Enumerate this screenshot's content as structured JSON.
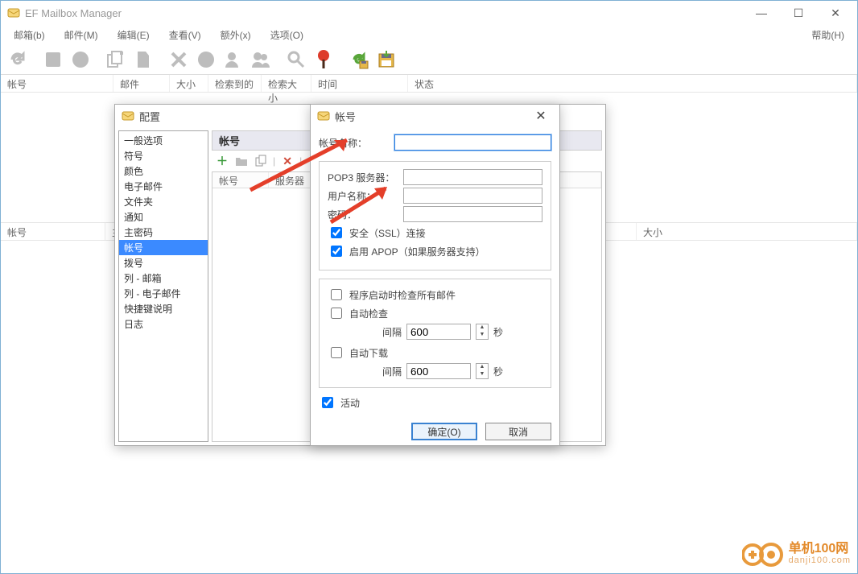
{
  "app": {
    "title": "EF Mailbox Manager"
  },
  "menu": {
    "mailbox": "邮箱(b)",
    "mail": "邮件(M)",
    "edit": "编辑(E)",
    "view": "查看(V)",
    "extra": "额外(x)",
    "options": "选项(O)",
    "help": "帮助(H)"
  },
  "upper_cols": {
    "account": "帐号",
    "mail": "邮件",
    "size": "大小",
    "found": "检索到的",
    "found_size": "检索大小",
    "time": "时间",
    "status": "状态"
  },
  "lower_cols": {
    "account": "帐号",
    "subject": "主题",
    "size": "大小"
  },
  "config_dialog": {
    "title": "配置",
    "nav": [
      "一般选项",
      "符号",
      "颜色",
      "电子邮件",
      "文件夹",
      "通知",
      "主密码",
      "帐号",
      "拨号",
      "列 - 邮箱",
      "列 - 电子邮件",
      "快捷键说明",
      "日志"
    ],
    "selected_index": 7,
    "panel_title": "帐号",
    "list_cols": {
      "account": "帐号",
      "server": "服务器"
    }
  },
  "account_dialog": {
    "title": "帐号",
    "labels": {
      "name": "帐号名称：",
      "pop3": "POP3 服务器：",
      "user": "用户名称：",
      "password": "密码：",
      "ssl": "安全（SSL）连接",
      "apop": "启用 APOP（如果服务器支持）",
      "check_start": "程序启动时检查所有邮件",
      "auto_check": "自动检查",
      "auto_download": "自动下载",
      "interval": "间隔",
      "seconds": "秒",
      "active": "活动",
      "ok": "确定(O)",
      "cancel": "取消"
    },
    "values": {
      "name": "",
      "pop3": "",
      "user": "",
      "password": "",
      "ssl": true,
      "apop": true,
      "check_start": false,
      "auto_check": false,
      "auto_download": false,
      "interval_check": "600",
      "interval_download": "600",
      "active": true
    }
  },
  "watermark": {
    "name": "单机100网",
    "url": "danji100.com"
  }
}
